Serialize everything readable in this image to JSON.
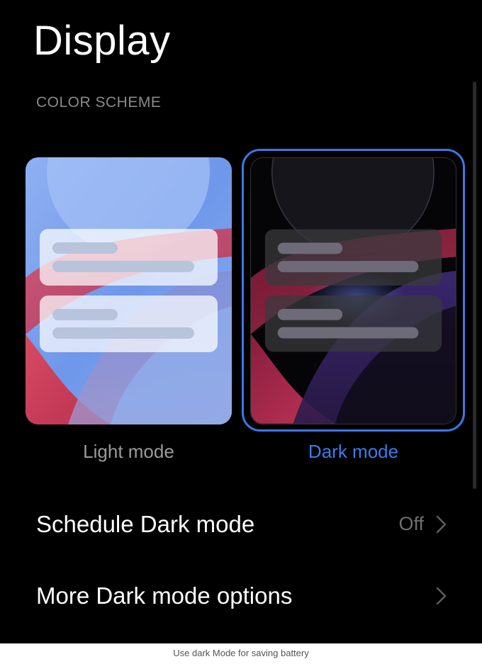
{
  "page": {
    "title": "Display"
  },
  "color_scheme": {
    "section_label": "COLOR SCHEME",
    "options": [
      {
        "label": "Light mode",
        "selected": false
      },
      {
        "label": "Dark mode",
        "selected": true
      }
    ],
    "accent_color": "#3b7ce8"
  },
  "settings": {
    "schedule_dark_mode": {
      "label": "Schedule Dark mode",
      "value": "Off",
      "icon": "chevron-right-icon"
    },
    "more_dark_mode_options": {
      "label": "More Dark mode options",
      "icon": "chevron-right-icon"
    }
  },
  "caption": {
    "text": "Use dark Mode for saving battery"
  }
}
